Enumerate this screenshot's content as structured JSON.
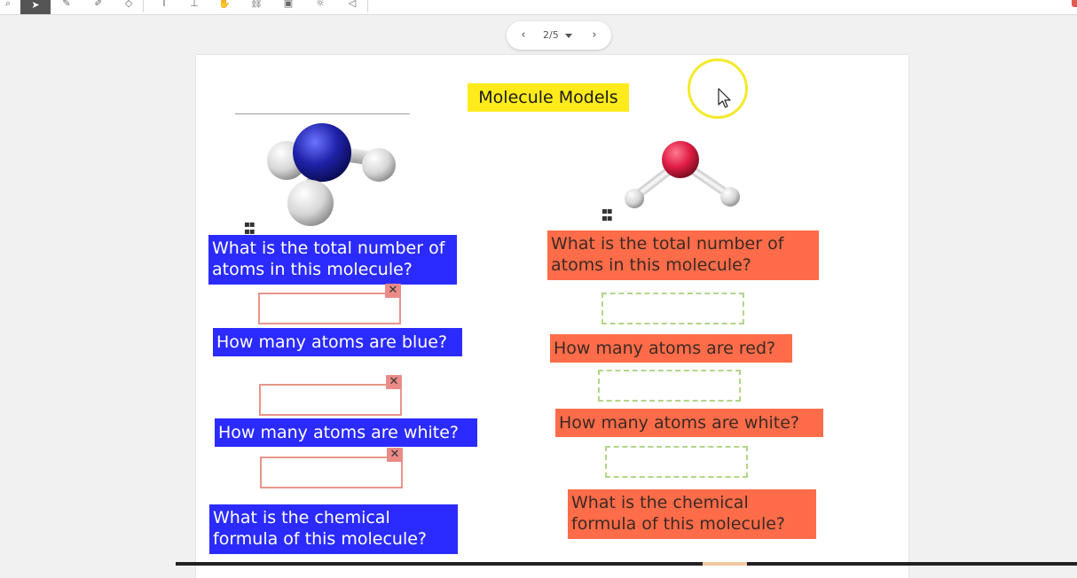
{
  "pager": {
    "prev_icon": "chevron-left-icon",
    "next_icon": "chevron-right-icon",
    "page_label": "2/5"
  },
  "worksheet": {
    "title": "Molecule Models",
    "left": {
      "questions": [
        "What is the total number of atoms in this molecule?",
        "How many atoms are blue?",
        "How many atoms are white?",
        "What is the chemical formula of this molecule?"
      ],
      "remove_icon": "close-icon"
    },
    "right": {
      "questions": [
        "What is the total number of atoms in this molecule?",
        "How many atoms are red?",
        "How many atoms are white?",
        "What is the chemical formula of this molecule?"
      ]
    }
  },
  "colors": {
    "title_bg": "#ffeb1c",
    "blue_label": "#2b2bff",
    "orange_label": "#ff6c49",
    "answer_border": "#e8958c",
    "drop_border": "#b2d58a"
  }
}
